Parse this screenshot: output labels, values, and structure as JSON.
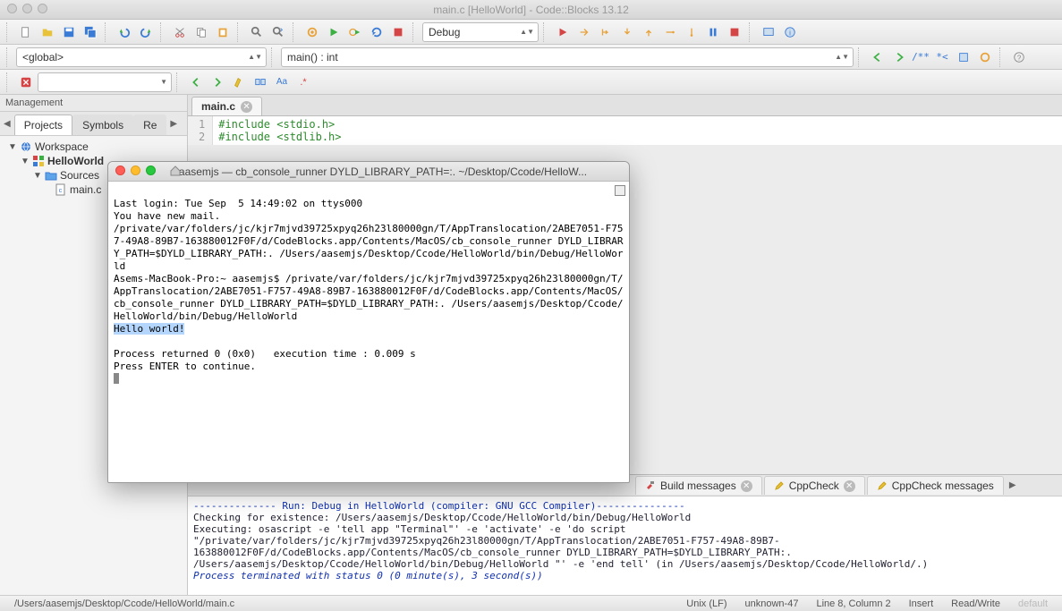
{
  "window": {
    "title": "main.c [HelloWorld] - Code::Blocks 13.12"
  },
  "toolbar": {
    "build_target_label": "Debug",
    "scope_label": "<global>",
    "function_label": "main() : int"
  },
  "sidebar": {
    "title": "Management",
    "tabs": [
      "Projects",
      "Symbols",
      "Re"
    ],
    "tree": {
      "workspace": "Workspace",
      "project": "HelloWorld",
      "sources_folder": "Sources",
      "file": "main.c"
    }
  },
  "editor": {
    "tab_label": "main.c",
    "lines": [
      {
        "n": "1",
        "text": "#include <stdio.h>"
      },
      {
        "n": "2",
        "text": "#include <stdlib.h>"
      }
    ]
  },
  "terminal": {
    "title": "aasemjs — cb_console_runner DYLD_LIBRARY_PATH=:. ~/Desktop/Ccode/HelloW...",
    "l1": "Last login: Tue Sep  5 14:49:02 on ttys000",
    "l2": "You have new mail.",
    "l3": "/private/var/folders/jc/kjr7mjvd39725xpyq26h23l80000gn/T/AppTranslocation/2ABE7051-F757-49A8-89B7-163880012F0F/d/CodeBlocks.app/Contents/MacOS/cb_console_runner DYLD_LIBRARY_PATH=$DYLD_LIBRARY_PATH:. /Users/aasemjs/Desktop/Ccode/HelloWorld/bin/Debug/HelloWorld",
    "l4": "Asems-MacBook-Pro:~ aasemjs$ /private/var/folders/jc/kjr7mjvd39725xpyq26h23l80000gn/T/AppTranslocation/2ABE7051-F757-49A8-89B7-163880012F0F/d/CodeBlocks.app/Contents/MacOS/cb_console_runner DYLD_LIBRARY_PATH=$DYLD_LIBRARY_PATH:. /Users/aasemjs/Desktop/Ccode/HelloWorld/bin/Debug/HelloWorld",
    "l5": "Hello world!",
    "l6": "",
    "l7": "Process returned 0 (0x0)   execution time : 0.009 s",
    "l8": "Press ENTER to continue."
  },
  "log_panel": {
    "tabs": [
      "Build messages",
      "CppCheck",
      "CppCheck messages"
    ],
    "header": "-------------- Run: Debug in HelloWorld (compiler: GNU GCC Compiler)---------------",
    "l1": "Checking for existence: /Users/aasemjs/Desktop/Ccode/HelloWorld/bin/Debug/HelloWorld",
    "l2": "Executing: osascript -e 'tell app \"Terminal\"' -e 'activate' -e 'do script \"/private/var/folders/jc/kjr7mjvd39725xpyq26h23l80000gn/T/AppTranslocation/2ABE7051-F757-49A8-89B7-163880012F0F/d/CodeBlocks.app/Contents/MacOS/cb_console_runner DYLD_LIBRARY_PATH=$DYLD_LIBRARY_PATH:. /Users/aasemjs/Desktop/Ccode/HelloWorld/bin/Debug/HelloWorld \"' -e 'end tell'  (in /Users/aasemjs/Desktop/Ccode/HelloWorld/.)",
    "l3": "Process terminated with status 0 (0 minute(s), 3 second(s))"
  },
  "status": {
    "path": "/Users/aasemjs/Desktop/Ccode/HelloWorld/main.c",
    "eol": "Unix (LF)",
    "encoding": "unknown-47",
    "pos": "Line 8, Column 2",
    "mode": "Insert",
    "rw": "Read/Write",
    "profile": "default"
  }
}
